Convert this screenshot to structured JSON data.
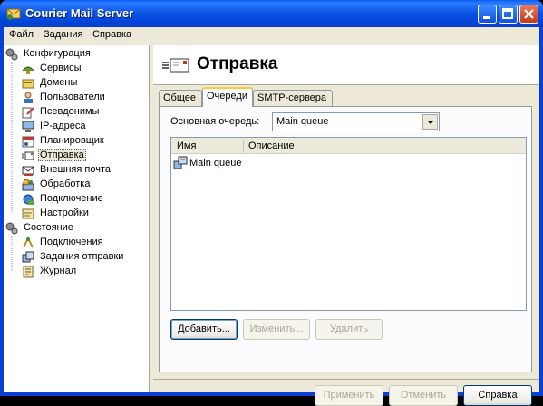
{
  "window": {
    "title": "Courier Mail Server"
  },
  "menu": [
    "Файл",
    "Задания",
    "Справка"
  ],
  "tree": {
    "items": [
      {
        "label": "Конфигурация",
        "icon": "gears-icon"
      },
      {
        "label": "Сервисы",
        "icon": "services-icon"
      },
      {
        "label": "Домены",
        "icon": "domains-icon"
      },
      {
        "label": "Пользователи",
        "icon": "users-icon"
      },
      {
        "label": "Псевдонимы",
        "icon": "aliases-icon"
      },
      {
        "label": "IP-адреса",
        "icon": "ip-addresses-icon"
      },
      {
        "label": "Планировщик",
        "icon": "scheduler-icon"
      },
      {
        "label": "Отправка",
        "icon": "outgoing-icon"
      },
      {
        "label": "Внешняя почта",
        "icon": "external-mail-icon"
      },
      {
        "label": "Обработка",
        "icon": "processing-icon"
      },
      {
        "label": "Подключение",
        "icon": "connection-icon"
      },
      {
        "label": "Настройки",
        "icon": "settings-icon"
      },
      {
        "label": "Состояние",
        "icon": "gears-icon"
      },
      {
        "label": "Подключения",
        "icon": "connections-icon"
      },
      {
        "label": "Задания отправки",
        "icon": "send-jobs-icon"
      },
      {
        "label": "Журнал",
        "icon": "log-icon"
      }
    ],
    "selected": "Отправка"
  },
  "page": {
    "title": "Отправка"
  },
  "tabs": [
    "Общее",
    "Очереди",
    "SMTP-сервера"
  ],
  "active_tab": "Очереди",
  "queue": {
    "label": "Основная очередь:",
    "value": "Main queue"
  },
  "list": {
    "columns": [
      "Имя",
      "Описание"
    ],
    "rows": [
      {
        "name": "Main queue",
        "description": ""
      }
    ]
  },
  "buttons": {
    "add": "Добавить...",
    "edit": "Изменить...",
    "delete": "Удалить",
    "apply": "Применить",
    "cancel": "Отменить",
    "help": "Справка"
  },
  "colors": {
    "titlebar": "#0A5CF2",
    "selection": "#ECE9D8",
    "face": "#ECE9D8"
  }
}
